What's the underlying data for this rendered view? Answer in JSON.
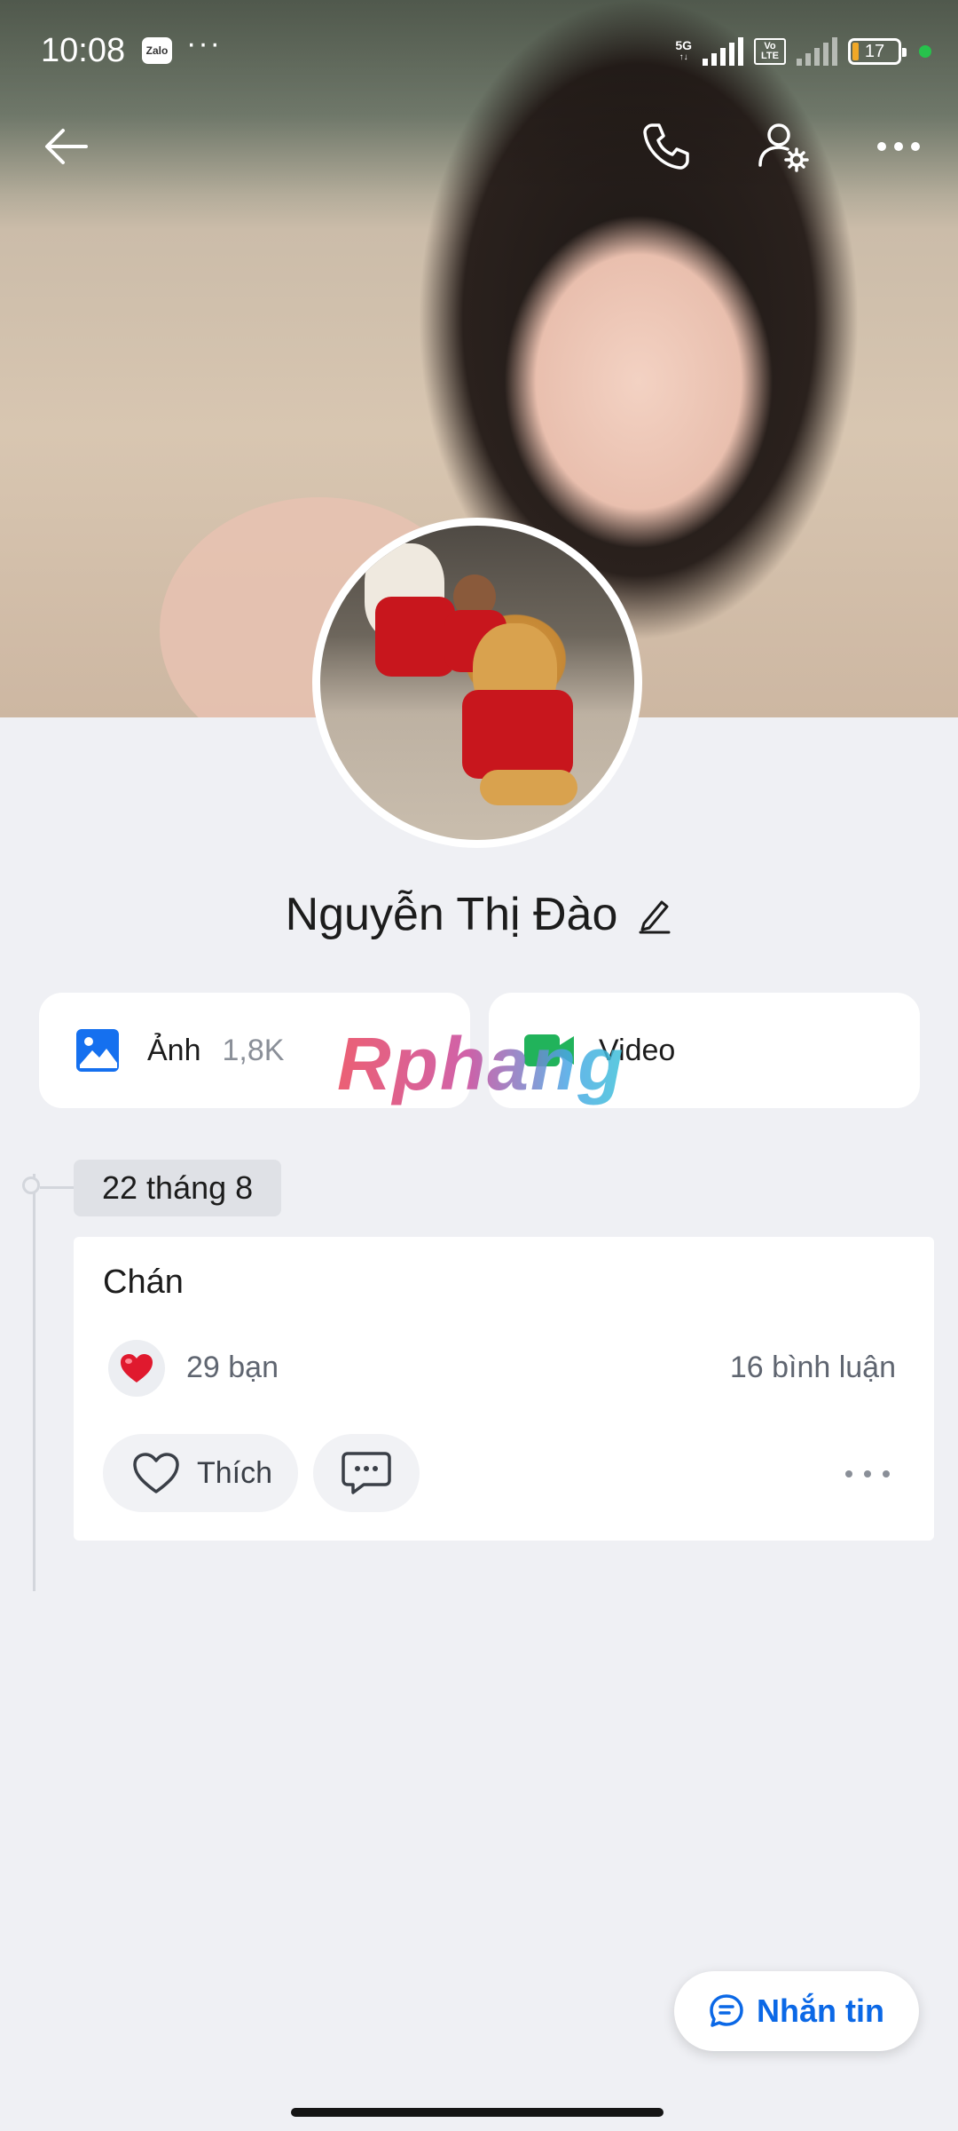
{
  "status_bar": {
    "time": "10:08",
    "app_badge": "Zalo",
    "network": "5G",
    "volte": "Vo LTE",
    "battery": "17"
  },
  "header": {
    "back": "back-arrow-icon",
    "actions": [
      "phone-icon",
      "user-settings-icon",
      "more-icon"
    ]
  },
  "profile": {
    "name": "Nguyễn Thị Đào"
  },
  "media": {
    "photos_label": "Ảnh",
    "photos_count": "1,8K",
    "video_label": "Video"
  },
  "watermark": "Rphang",
  "timeline": {
    "date": "22 tháng 8",
    "post": {
      "text": "Chán",
      "reactions": "29 bạn",
      "comments": "16 bình luận",
      "like_label": "Thích"
    }
  },
  "message_button": {
    "label": "Nhắn tin"
  },
  "colors": {
    "accent": "#0b68e6",
    "photo_icon": "#1570ef",
    "video_icon": "#21b35b",
    "heart": "#e0192e"
  }
}
